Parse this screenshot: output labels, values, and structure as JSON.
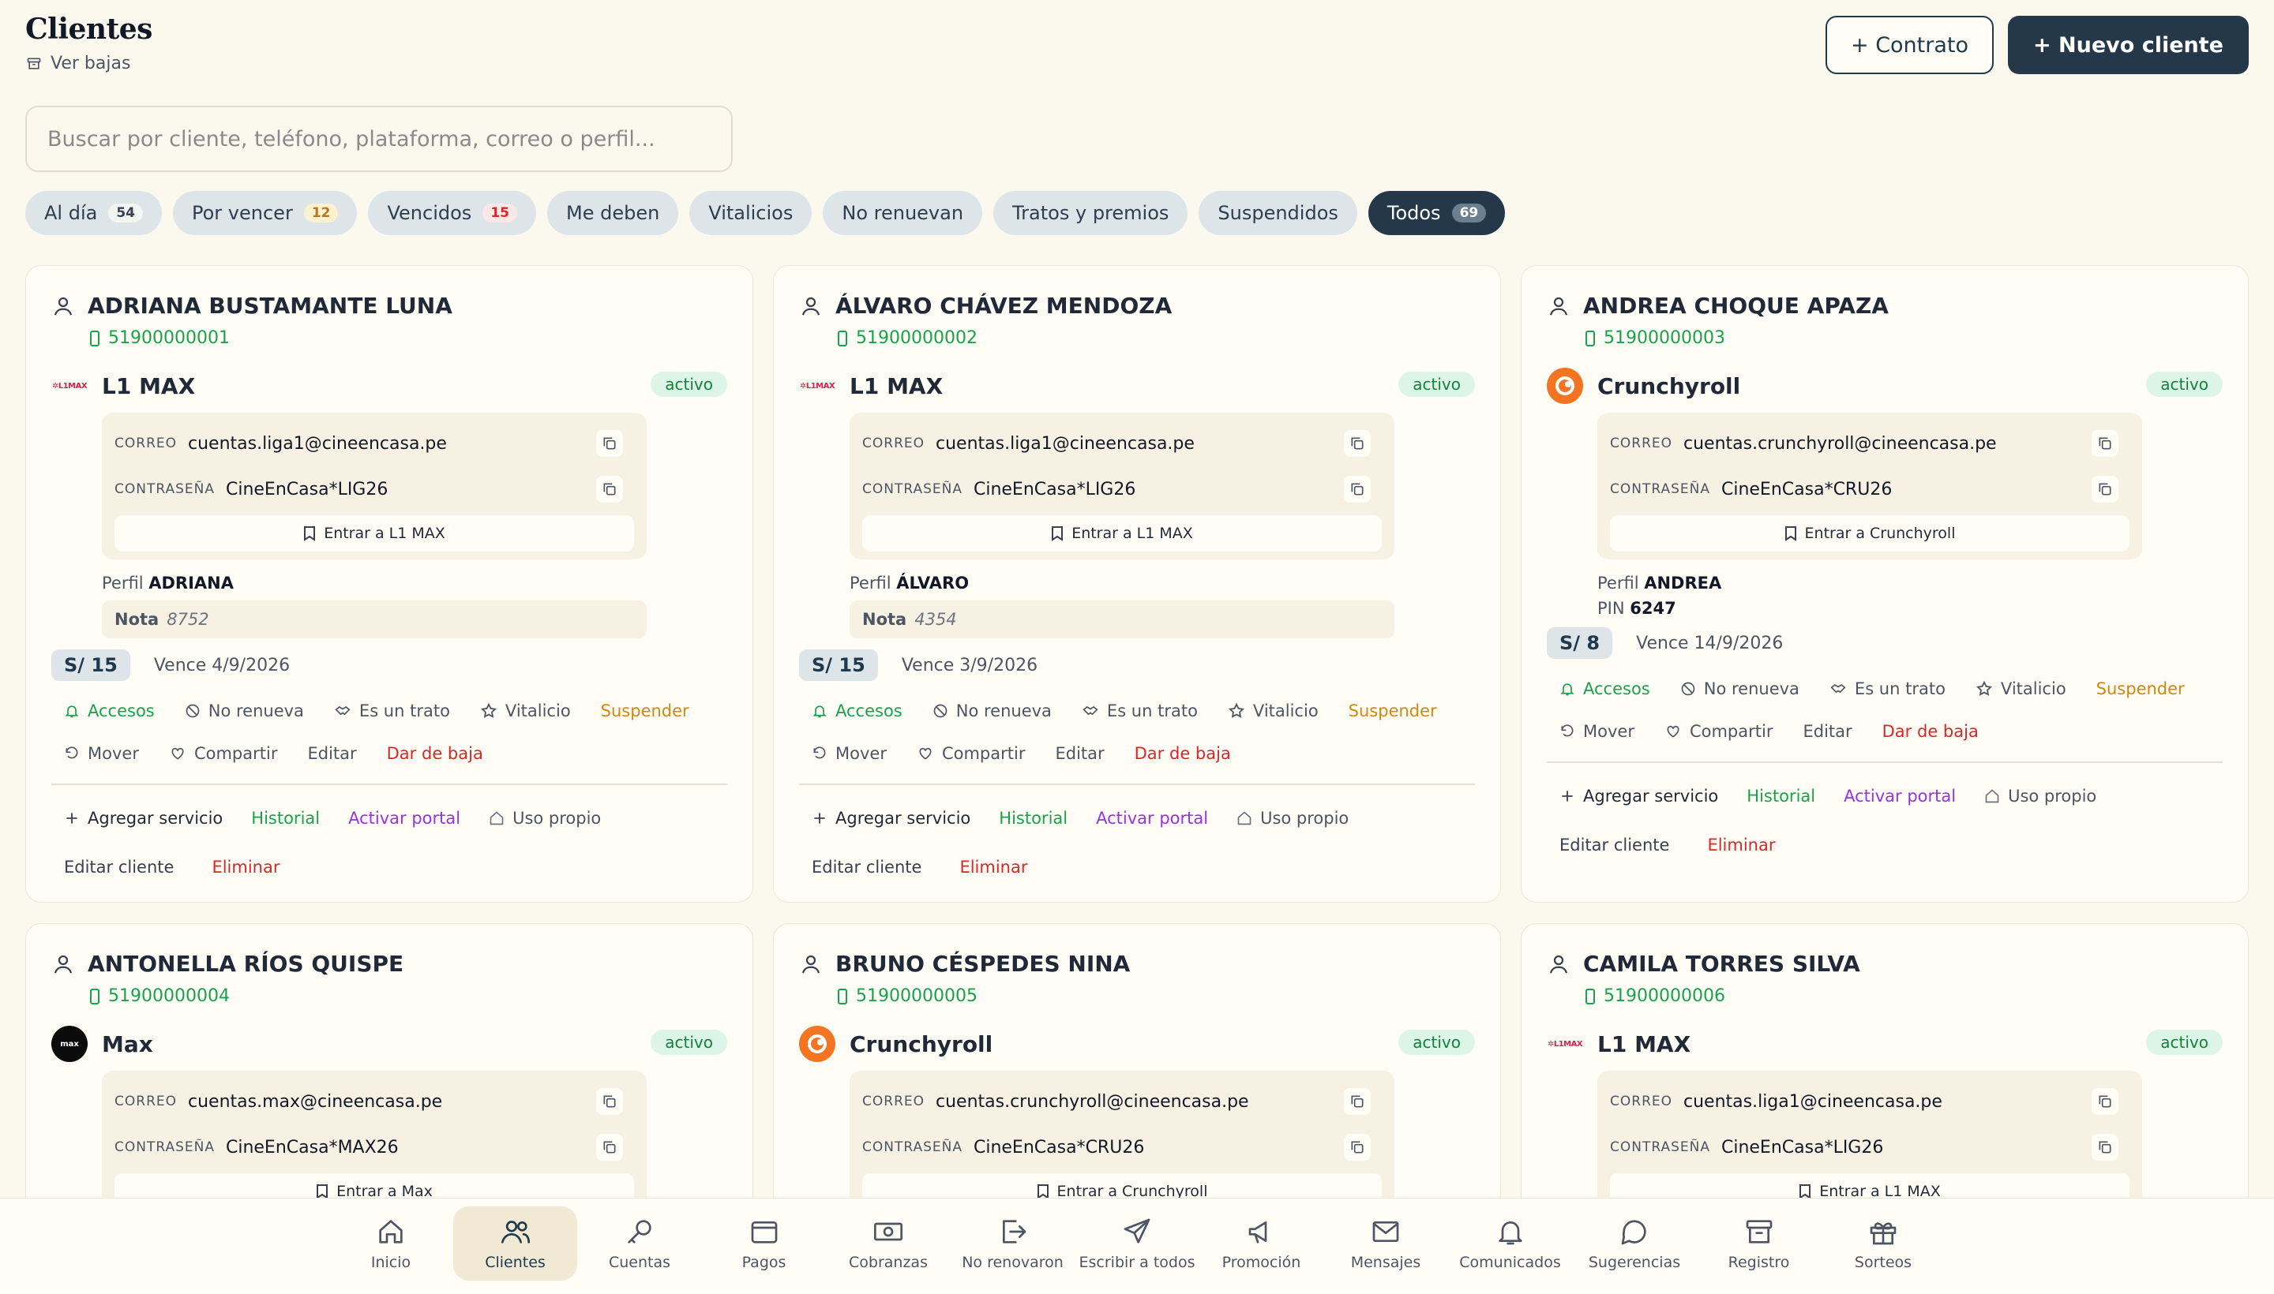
{
  "header": {
    "title": "Clientes",
    "ver_bajas": "Ver bajas",
    "contrato_label": "+ Contrato",
    "nuevo_label": "+ Nuevo cliente"
  },
  "search": {
    "placeholder": "Buscar por cliente, teléfono, plataforma, correo o perfil...",
    "value": ""
  },
  "filters": [
    {
      "label": "Al día",
      "count": "54"
    },
    {
      "label": "Por vencer",
      "count": "12"
    },
    {
      "label": "Vencidos",
      "count": "15"
    },
    {
      "label": "Me deben"
    },
    {
      "label": "Vitalicios"
    },
    {
      "label": "No renuevan"
    },
    {
      "label": "Tratos y premios"
    },
    {
      "label": "Suspendidos"
    },
    {
      "label": "Todos",
      "count": "69",
      "active": true
    }
  ],
  "labels": {
    "correo": "CORREO",
    "contrasena": "CONTRASEÑA",
    "perfil": "Perfil",
    "pin": "PIN",
    "nota": "Nota",
    "accesos": "Accesos",
    "no_renueva": "No renueva",
    "es_trato": "Es un trato",
    "vitalicio": "Vitalicio",
    "suspender": "Suspender",
    "mover": "Mover",
    "compartir": "Compartir",
    "editar": "Editar",
    "dar_baja": "Dar de baja",
    "agregar": "Agregar servicio",
    "historial": "Historial",
    "activar": "Activar portal",
    "uso_propio": "Uso propio",
    "editar_cliente": "Editar cliente",
    "eliminar": "Eliminar"
  },
  "clients": [
    {
      "name": "ADRIANA BUSTAMANTE LUNA",
      "phone": "51900000001",
      "service": "L1 MAX",
      "logo": "L1MAX",
      "status": "activo",
      "email": "cuentas.liga1@cineencasa.pe",
      "password": "CineEnCasa*LIG26",
      "enter": "Entrar a L1 MAX",
      "perfil": "ADRIANA",
      "nota": "8752",
      "price": "S/ 15",
      "vence": "Vence 4/9/2026"
    },
    {
      "name": "ÁLVARO CHÁVEZ MENDOZA",
      "phone": "51900000002",
      "service": "L1 MAX",
      "logo": "L1MAX",
      "status": "activo",
      "email": "cuentas.liga1@cineencasa.pe",
      "password": "CineEnCasa*LIG26",
      "enter": "Entrar a L1 MAX",
      "perfil": "ÁLVARO",
      "nota": "4354",
      "price": "S/ 15",
      "vence": "Vence 3/9/2026"
    },
    {
      "name": "ANDREA CHOQUE APAZA",
      "phone": "51900000003",
      "service": "Crunchyroll",
      "logo": "C",
      "status": "activo",
      "email": "cuentas.crunchyroll@cineencasa.pe",
      "password": "CineEnCasa*CRU26",
      "enter": "Entrar a Crunchyroll",
      "perfil": "ANDREA",
      "pin": "6247",
      "price": "S/ 8",
      "vence": "Vence 14/9/2026"
    },
    {
      "name": "ANTONELLA RÍOS QUISPE",
      "phone": "51900000004",
      "service": "Max",
      "logo": "max",
      "status": "activo",
      "email": "cuentas.max@cineencasa.pe",
      "password": "CineEnCasa*MAX26",
      "enter": "Entrar a Max"
    },
    {
      "name": "BRUNO CÉSPEDES NINA",
      "phone": "51900000005",
      "service": "Crunchyroll",
      "logo": "C",
      "status": "activo",
      "email": "cuentas.crunchyroll@cineencasa.pe",
      "password": "CineEnCasa*CRU26",
      "enter": "Entrar a Crunchyroll"
    },
    {
      "name": "CAMILA TORRES SILVA",
      "phone": "51900000006",
      "service": "L1 MAX",
      "logo": "L1MAX",
      "status": "activo",
      "email": "cuentas.liga1@cineencasa.pe",
      "password": "CineEnCasa*LIG26",
      "enter": "Entrar a L1 MAX"
    }
  ],
  "nav": [
    {
      "label": "Inicio",
      "icon": "home-icon"
    },
    {
      "label": "Clientes",
      "icon": "users-icon",
      "active": true
    },
    {
      "label": "Cuentas",
      "icon": "key-icon"
    },
    {
      "label": "Pagos",
      "icon": "wallet-icon"
    },
    {
      "label": "Cobranzas",
      "icon": "cash-icon"
    },
    {
      "label": "No renovaron",
      "icon": "logout-icon"
    },
    {
      "label": "Escribir a todos",
      "icon": "send-icon"
    },
    {
      "label": "Promoción",
      "icon": "megaphone-icon"
    },
    {
      "label": "Mensajes",
      "icon": "mail-icon"
    },
    {
      "label": "Comunicados",
      "icon": "bell-icon"
    },
    {
      "label": "Sugerencias",
      "icon": "chat-icon"
    },
    {
      "label": "Registro",
      "icon": "archive-icon"
    },
    {
      "label": "Sorteos",
      "icon": "gift-icon"
    }
  ]
}
